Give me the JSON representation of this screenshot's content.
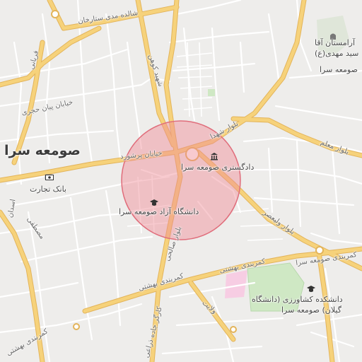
{
  "map": {
    "city_label": "صومعه سرا",
    "city_label_left": "صومعه س",
    "poi": {
      "court": "دادگستری صومعه سرا",
      "azad_univ": "دانشگاه آزاد صومعه سرا",
      "bank": "بانک تجارت",
      "agri_college_line1": "دانشکده کشاورزی (دانشگاه",
      "agri_college_line2": "گیلان) صومعه سرا",
      "shrine_line1": "آرامستان آقا",
      "shrine_line2": "سید مهدی(ع)",
      "shrine_line3": "صومعه سرا"
    },
    "roads": {
      "sattarkhan": "شالده مدی ستارخان",
      "shahid_kohan": "شهید کوهن",
      "faryani": "فریانی",
      "hejri": "خیابان پیان حجری",
      "boroushkourd": "خیابان پرشورد",
      "shohada": "بلوار شهدا",
      "moallem": "بلوار معلم",
      "valiasr": "بلوار ولیعصر",
      "salehi": "بلوار صالحی",
      "kamarbandi_1": "کمربندی بهشتی",
      "kamarbandi_2": "کمربندی بهشتی",
      "kamarbandi_east": "کمربندی صومعه سرا",
      "kamarbandi_west": "کمربندی بهشتی",
      "kargar": "کارگر جاده ذراعی",
      "velayat": "ولایت",
      "ostadan": "اسدان",
      "mostafa": "مصطفی"
    },
    "colors": {
      "background": "#eeedeb",
      "street": "#ffffff",
      "main_road": "#f6d27b",
      "main_road_casing": "#e3b45a",
      "highlight_fill": "#f08a95",
      "highlight_stroke": "#e06d7b",
      "park": "#cfe8c4",
      "pink_area": "#f7cde3"
    }
  }
}
